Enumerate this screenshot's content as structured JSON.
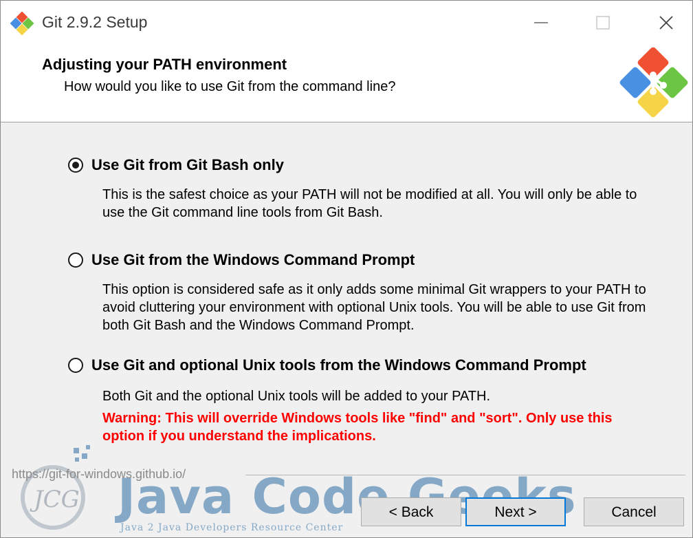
{
  "window": {
    "title": "Git 2.9.2 Setup"
  },
  "header": {
    "title": "Adjusting your PATH environment",
    "subtitle": "How would you like to use Git from the command line?"
  },
  "options": [
    {
      "label": "Use Git from Git Bash only",
      "selected": true,
      "description": "This is the safest choice as your PATH will not be modified at all. You will only be able to use the Git command line tools from Git Bash."
    },
    {
      "label": "Use Git from the Windows Command Prompt",
      "selected": false,
      "description": "This option is considered safe as it only adds some minimal Git wrappers to your PATH to avoid cluttering your environment with optional Unix tools. You will be able to use Git from both Git Bash and the Windows Command Prompt."
    },
    {
      "label": "Use Git and optional Unix tools from the Windows Command Prompt",
      "selected": false,
      "description": "Both Git and the optional Unix tools will be added to your PATH.",
      "warning": "Warning: This will override Windows tools like \"find\" and \"sort\". Only use this option if you understand the implications."
    }
  ],
  "footer": {
    "url": "https://git-for-windows.github.io/",
    "back_label": "< Back",
    "next_label": "Next >",
    "cancel_label": "Cancel"
  },
  "watermark": {
    "brand": "Java Code Geeks",
    "tagline": "Java 2 Java Developers Resource Center",
    "monogram": "JCG"
  },
  "icons": {
    "app": "git-logo-icon",
    "minimize": "minimize-icon",
    "maximize": "maximize-icon",
    "close": "close-icon"
  },
  "colors": {
    "warning": "#ff0000",
    "focus_border": "#0078d7",
    "git_red": "#f05133",
    "git_green": "#6cc644",
    "git_blue": "#4a90e2",
    "git_yellow": "#f5d547"
  }
}
